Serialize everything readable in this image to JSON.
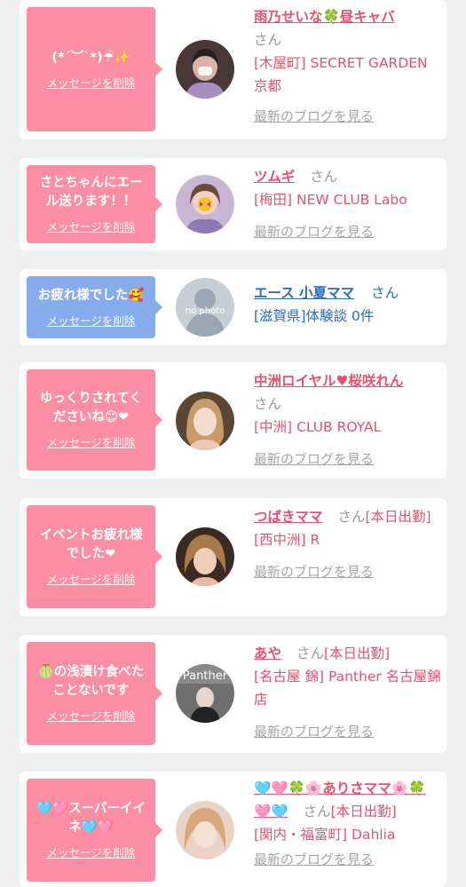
{
  "delete_label": "メッセージを削除",
  "blog_label": "最新のブログを見る",
  "san_label": "さん",
  "colors": {
    "accent_pink": "#e8506f",
    "bubble_pink": "#fb8ea2",
    "bubble_blue": "#86acee",
    "accent_blue": "#2a6bb8"
  },
  "items": [
    {
      "message": "(*´︶`*)☔✨",
      "name": "雨乃せいな🍀昼キャバ",
      "shop": "[木屋町] SECRET GARDEN 京都",
      "has_blog": true,
      "type": "pink"
    },
    {
      "message": "さとちゃんにエール送ります！！",
      "name": "ツムギ",
      "shop": "[梅田] NEW CLUB Labo",
      "has_blog": true,
      "type": "pink"
    },
    {
      "message": "お疲れ様でした🥰",
      "name": "エース 小夏ママ",
      "shop": "[滋賀県]体験談 0件",
      "has_blog": false,
      "type": "blue",
      "avatar_text": "no photo"
    },
    {
      "message": "ゆっくりされてくださいね😊❤",
      "name": "中洲ロイヤル♥桜咲れん",
      "shop": "[中洲] CLUB ROYAL",
      "has_blog": true,
      "type": "pink"
    },
    {
      "message": "イベントお疲れ様でした❤",
      "name": "つばきママ",
      "status": "[本日出勤]",
      "shop": "[西中洲] R",
      "has_blog": true,
      "type": "pink"
    },
    {
      "message": "🍈の浅漬け食べたことないです",
      "name": "あや",
      "status": "[本日出勤]",
      "shop": "[名古屋 錦] Panther 名古屋錦店",
      "has_blog": true,
      "type": "pink",
      "avatar_text": "Panther"
    },
    {
      "message": "🩵🩷スーパーイイネ🩵🩷",
      "name": "🩵🩷🍀🌸ありさママ🌸🍀🩷🩵",
      "status": "[本日出勤]",
      "shop": "[関内・福富町] Dahlia",
      "has_blog": true,
      "type": "pink"
    }
  ]
}
